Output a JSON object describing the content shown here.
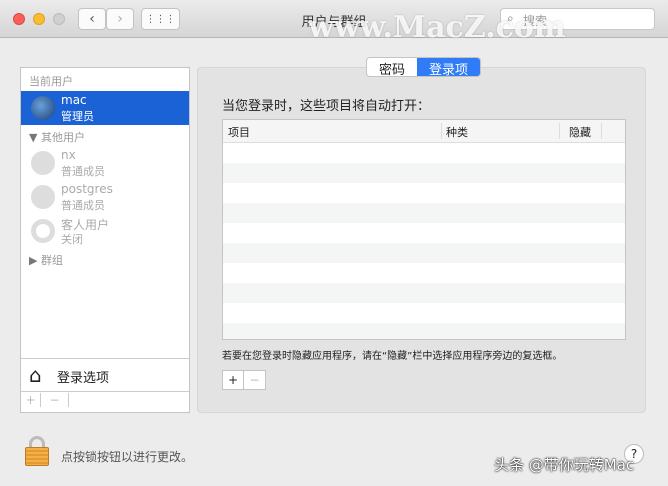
{
  "window": {
    "title": "用户与群组",
    "search_placeholder": "搜索",
    "watermark": "www.MacZ.com"
  },
  "sidebar": {
    "current_header": "当前用户",
    "current_user": {
      "name": "mac",
      "role": "管理员"
    },
    "others_header": "其他用户",
    "others": [
      {
        "name": "nx",
        "role": "普通成员"
      },
      {
        "name": "postgres",
        "role": "普通成员"
      },
      {
        "name": "客人用户",
        "role": "关闭"
      }
    ],
    "groups_header": "群组",
    "login_options": "登录选项",
    "add": "+",
    "remove": "−"
  },
  "tabs": [
    {
      "label": "密码",
      "active": false
    },
    {
      "label": "登录项",
      "active": true
    }
  ],
  "main": {
    "intro": "当您登录时，这些项目将自动打开：",
    "columns": [
      "项目",
      "种类",
      "隐藏"
    ],
    "rows": [],
    "note": "若要在您登录时隐藏应用程序，请在“隐藏”栏中选择应用程序旁边的复选框。",
    "add": "+",
    "remove": "−"
  },
  "footer": {
    "lock_text": "点按锁按钮以进行更改。",
    "help": "?",
    "watermark": "头条 @带你玩转Mac"
  },
  "colors": {
    "accent": "#1a62d5",
    "tab_active": "#2f7cf6"
  }
}
